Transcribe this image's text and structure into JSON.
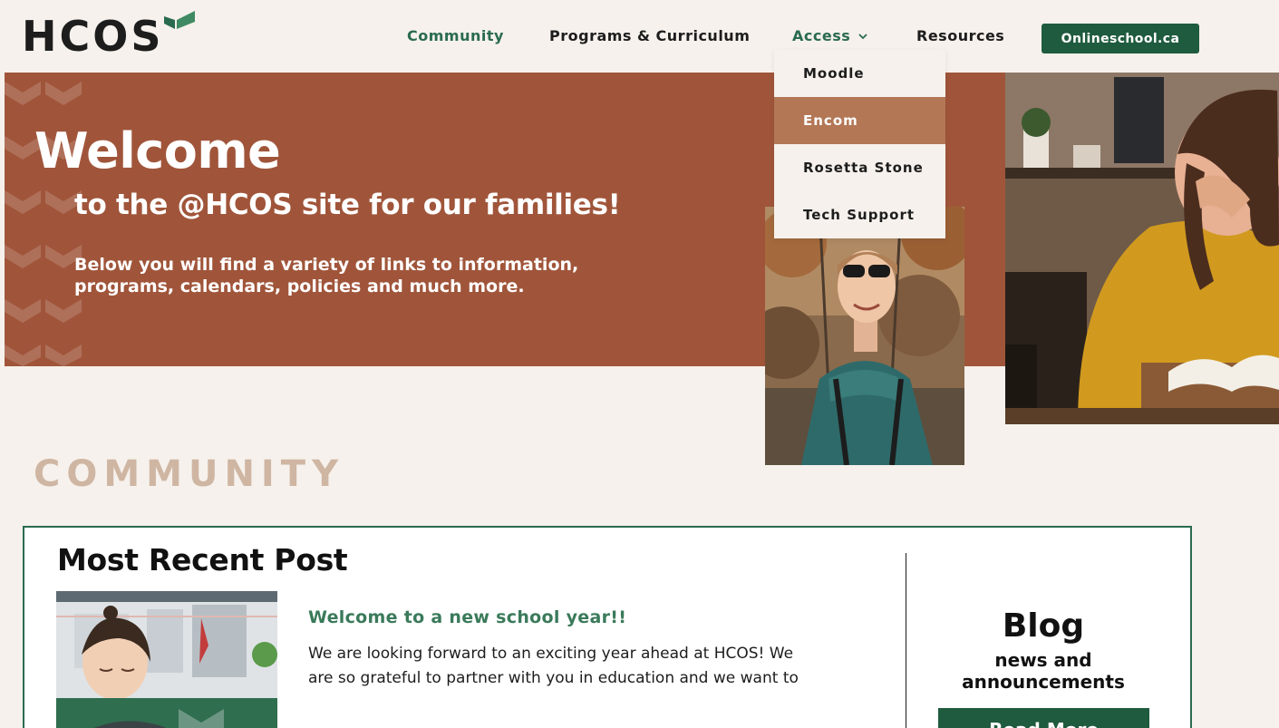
{
  "header": {
    "logo_text": "HCOS",
    "nav": [
      {
        "label": "Community"
      },
      {
        "label": "Programs & Curriculum"
      },
      {
        "label": "Access"
      },
      {
        "label": "Resources"
      }
    ],
    "cta_label": "Onlineschool.ca"
  },
  "dropdown": {
    "items": [
      {
        "label": "Moodle"
      },
      {
        "label": "Encom"
      },
      {
        "label": "Rosetta Stone"
      },
      {
        "label": "Tech Support"
      }
    ],
    "highlighted": "Encom"
  },
  "hero": {
    "title": "Welcome",
    "subtitle": "to the @HCOS site for our families!",
    "body": "Below you will find a variety of links to information, programs, calendars, policies and much more."
  },
  "community": {
    "heading": "COMMUNITY",
    "post": {
      "section_title": "Most Recent Post",
      "article_title": "Welcome to a new school year!!",
      "excerpt": "We are looking forward to an exciting year ahead at HCOS! We are so grateful to partner with you in education and we want to"
    },
    "blog": {
      "title": "Blog",
      "subtitle": "news and announcements",
      "button_label": "Read More"
    }
  },
  "colors": {
    "page_bg": "#f6f1ec",
    "hero_bg": "#a0553a",
    "brand_green": "#1f5b3e",
    "accent_green": "#2a6b4f",
    "dropdown_highlight": "#b37755",
    "community_heading": "#cfb6a3"
  },
  "icons": {
    "logo_mark": "leaf-chevron-icon",
    "access_caret": "chevron-down-icon"
  }
}
